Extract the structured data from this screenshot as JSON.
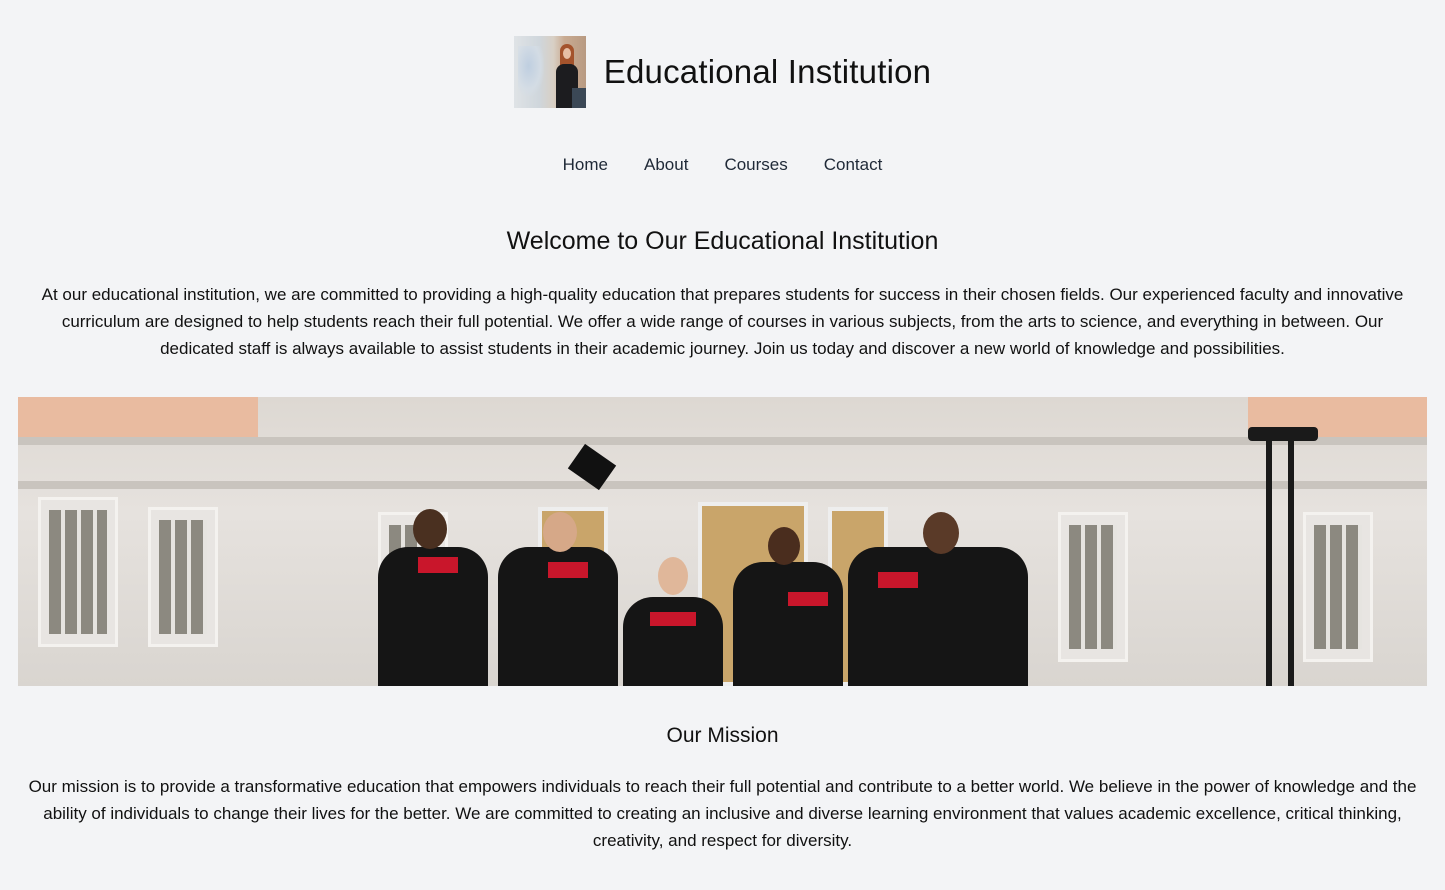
{
  "header": {
    "logo_alt": "Educational Institution logo",
    "title": "Educational Institution"
  },
  "nav": {
    "items": [
      {
        "label": "Home"
      },
      {
        "label": "About"
      },
      {
        "label": "Courses"
      },
      {
        "label": "Contact"
      }
    ]
  },
  "welcome": {
    "title": "Welcome to Our Educational Institution",
    "text": "At our educational institution, we are committed to providing a high-quality education that prepares students for success in their chosen fields. Our experienced faculty and innovative curriculum are designed to help students reach their full potential. We offer a wide range of courses in various subjects, from the arts to science, and everything in between. Our dedicated staff is always available to assist students in their academic journey. Join us today and discover a new world of knowledge and possibilities."
  },
  "hero": {
    "alt": "Graduates tossing caps in front of a building"
  },
  "mission": {
    "title": "Our Mission",
    "text": "Our mission is to provide a transformative education that empowers individuals to reach their full potential and contribute to a better world. We believe in the power of knowledge and the ability of individuals to change their lives for the better. We are committed to creating an inclusive and diverse learning environment that values academic excellence, critical thinking, creativity, and respect for diversity."
  },
  "colors": {
    "background": "#f3f4f6",
    "text": "#111111",
    "nav_text": "#1f2937"
  }
}
